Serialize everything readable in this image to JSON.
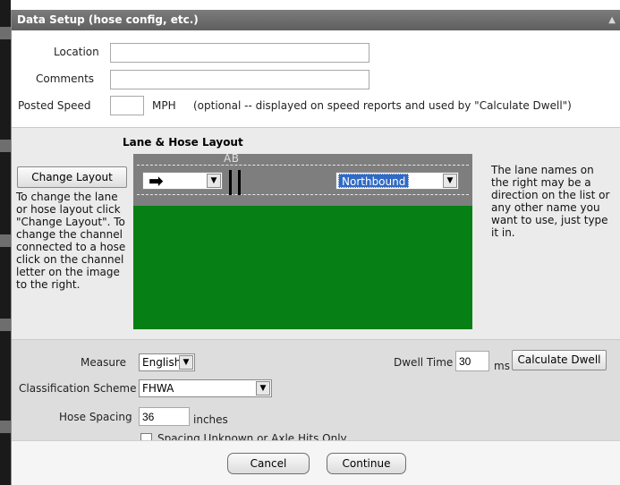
{
  "window": {
    "title": "Data Setup (hose config, etc.)",
    "title_caret": "▲"
  },
  "general": {
    "location_label": "Location",
    "location_value": "",
    "comments_label": "Comments",
    "comments_value": "",
    "posted_speed_label": "Posted Speed",
    "posted_speed_value": "",
    "speed_unit": "MPH",
    "speed_note": "(optional -- displayed on speed reports and used by \"Calculate Dwell\")"
  },
  "lane_layout": {
    "title": "Lane & Hose Layout",
    "change_layout_label": "Change Layout",
    "help_left": "To change the lane or hose layout click \"Change Layout\". To change the channel connected to a hose click on the channel letter on the image to the right.",
    "help_right": "The lane names on the right may be a direction on the list or any other name you want to use, just type it in.",
    "hose_channels_label": "AB",
    "direction_value": "Northbound",
    "arrow_icon": "right-arrow-icon",
    "dropdown_icon": "chevron-down-icon",
    "panel_color": "#067f14",
    "road_color": "#7e7e7e"
  },
  "settings": {
    "measure_label": "Measure",
    "measure_value": "English",
    "classification_label": "Classification Scheme",
    "classification_value": "FHWA",
    "hose_spacing_label": "Hose Spacing",
    "hose_spacing_value": "36",
    "hose_spacing_unit": "inches",
    "spacing_unknown_label": "Spacing Unknown or Axle Hits Only",
    "spacing_unknown_checked": false,
    "dwell_time_label": "Dwell Time",
    "dwell_time_value": "30",
    "dwell_time_unit": "ms",
    "calculate_dwell_label": "Calculate Dwell"
  },
  "footer": {
    "cancel_label": "Cancel",
    "continue_label": "Continue"
  }
}
